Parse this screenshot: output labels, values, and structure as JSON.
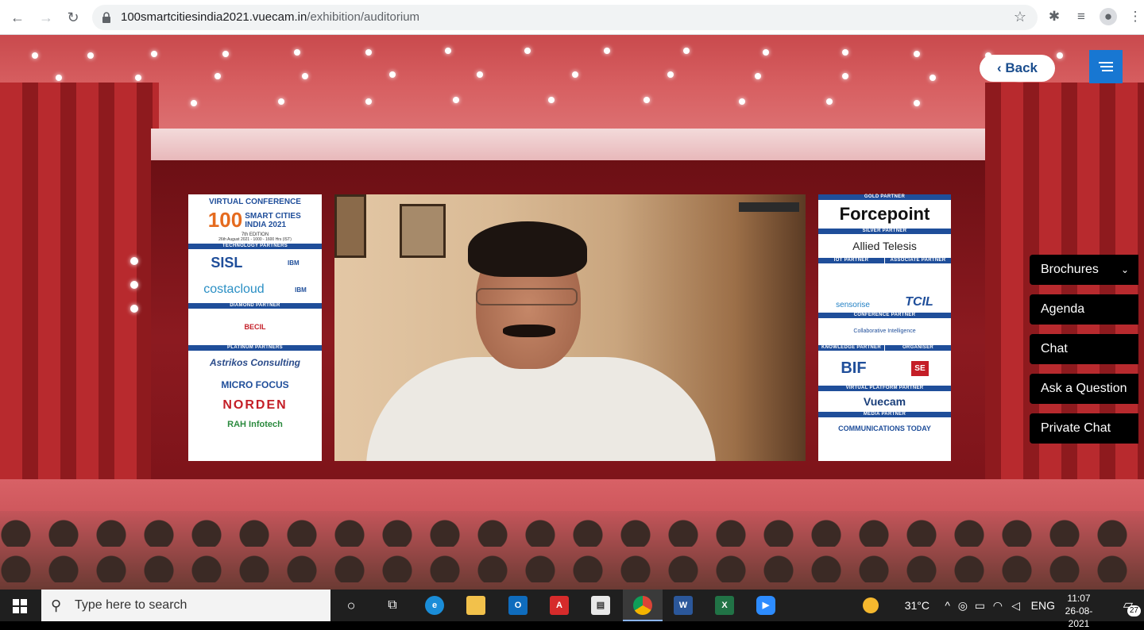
{
  "browser": {
    "url_host": "100smartcitiesindia2021.vuecam.in",
    "url_path": "/exhibition/auditorium"
  },
  "stage": {
    "left_banner": {
      "title": "VIRTUAL CONFERENCE",
      "event_number": "100",
      "event_name": "SMART CITIES INDIA 2021",
      "edition": "7th EDITION",
      "date": "26th August 2021 - 1000 - 1600 Hrs (IST)",
      "sections": [
        {
          "heading": "TECHNOLOGY PARTNERS",
          "logos": [
            "SISL",
            "IBM",
            "costacloud",
            "IBM"
          ]
        },
        {
          "heading": "DIAMOND PARTNER",
          "logos": [
            "BECIL"
          ]
        },
        {
          "heading": "PLATINUM PARTNERS",
          "logos": [
            "Astrikos Consulting",
            "MICRO FOCUS",
            "NORDEN",
            "RAH Infotech"
          ]
        }
      ]
    },
    "right_banner": {
      "sections": [
        {
          "heading": "GOLD PARTNER",
          "logos": [
            "Forcepoint"
          ]
        },
        {
          "heading": "SILVER PARTNER",
          "logos": [
            "Allied Telesis"
          ]
        },
        {
          "heading": "IOT PARTNER",
          "logos": [
            "sensorise"
          ]
        },
        {
          "heading": "ASSOCIATE PARTNER",
          "logos": [
            "TCIL"
          ]
        },
        {
          "heading": "CONFERENCE PARTNER",
          "logos": [
            "Collaborative Intelligence"
          ]
        },
        {
          "heading": "KNOWLEDGE PARTNER",
          "logos": [
            "BIF"
          ]
        },
        {
          "heading": "ORGANISER",
          "logos": [
            "SE"
          ]
        },
        {
          "heading": "VIRTUAL PLATFORM PARTNER",
          "logos": [
            "Vuecam"
          ]
        },
        {
          "heading": "MEDIA PARTNER",
          "logos": [
            "COMMUNICATIONS TODAY"
          ]
        }
      ]
    }
  },
  "nav": {
    "back_label": "Back"
  },
  "side_menu": [
    {
      "label": "Brochures",
      "has_dropdown": true
    },
    {
      "label": "Agenda"
    },
    {
      "label": "Chat"
    },
    {
      "label": "Ask a Question"
    },
    {
      "label": "Private Chat"
    }
  ],
  "taskbar": {
    "search_placeholder": "Type here to search",
    "temperature": "31°C",
    "language": "ENG",
    "time": "11:07",
    "date": "26-08-2021",
    "notification_count": "27"
  }
}
